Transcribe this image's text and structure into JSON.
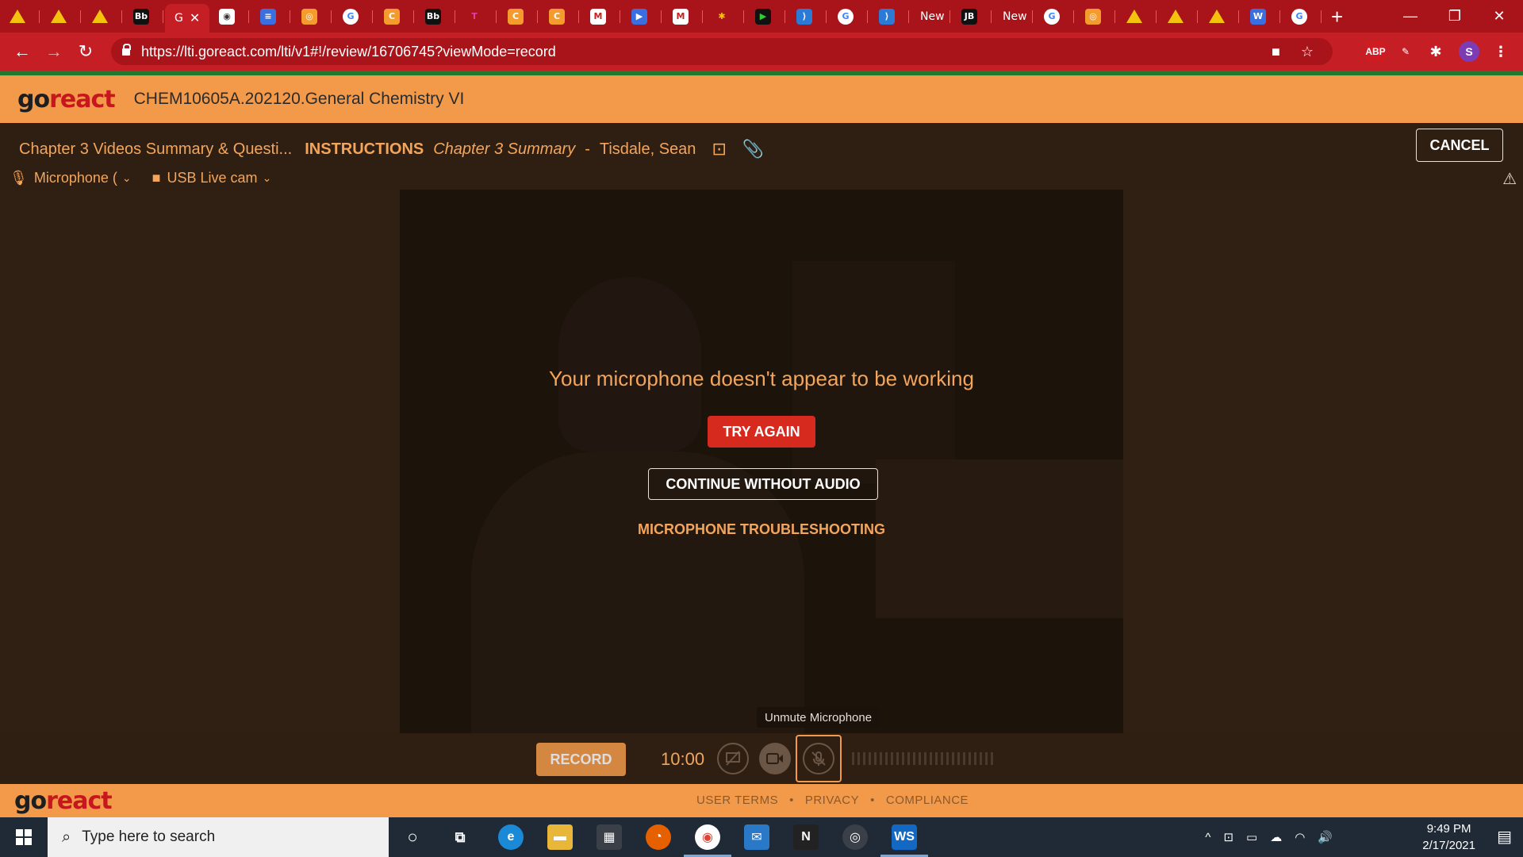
{
  "browser": {
    "active_tab_label": "G",
    "tab_text_labels": [
      "New",
      "New"
    ],
    "url": "https://lti.goreact.com/lti/v1#!/review/16706745?viewMode=record",
    "extension_abp": "ABP",
    "profile_initial": "S"
  },
  "header": {
    "logo_go": "go",
    "logo_react": "react",
    "course": "CHEM10605A.202120.General Chemistry VI"
  },
  "assignment": {
    "title": "Chapter 3 Videos Summary & Questi...",
    "instructions_label": "INSTRUCTIONS",
    "activity": "Chapter 3 Summary",
    "separator": "-",
    "student": "Tisdale, Sean",
    "cancel_label": "CANCEL"
  },
  "devices": {
    "microphone": "Microphone (",
    "camera": "USB Live cam"
  },
  "overlay": {
    "message": "Your microphone doesn't appear to be working",
    "try_again": "TRY AGAIN",
    "continue": "CONTINUE WITHOUT AUDIO",
    "troubleshooting": "MICROPHONE TROUBLESHOOTING",
    "tooltip": "Unmute Microphone"
  },
  "recorder": {
    "record_label": "RECORD",
    "time": "10:00"
  },
  "footer": {
    "links": [
      "USER TERMS",
      "PRIVACY",
      "COMPLIANCE"
    ],
    "sep": "•"
  },
  "taskbar": {
    "search_placeholder": "Type here to search",
    "time": "9:49 PM",
    "date": "2/17/2021"
  },
  "colors": {
    "accent": "#f29a4a",
    "brand_red": "#c7161d",
    "try_again": "#d62a1f",
    "browser_red": "#c51f25"
  }
}
